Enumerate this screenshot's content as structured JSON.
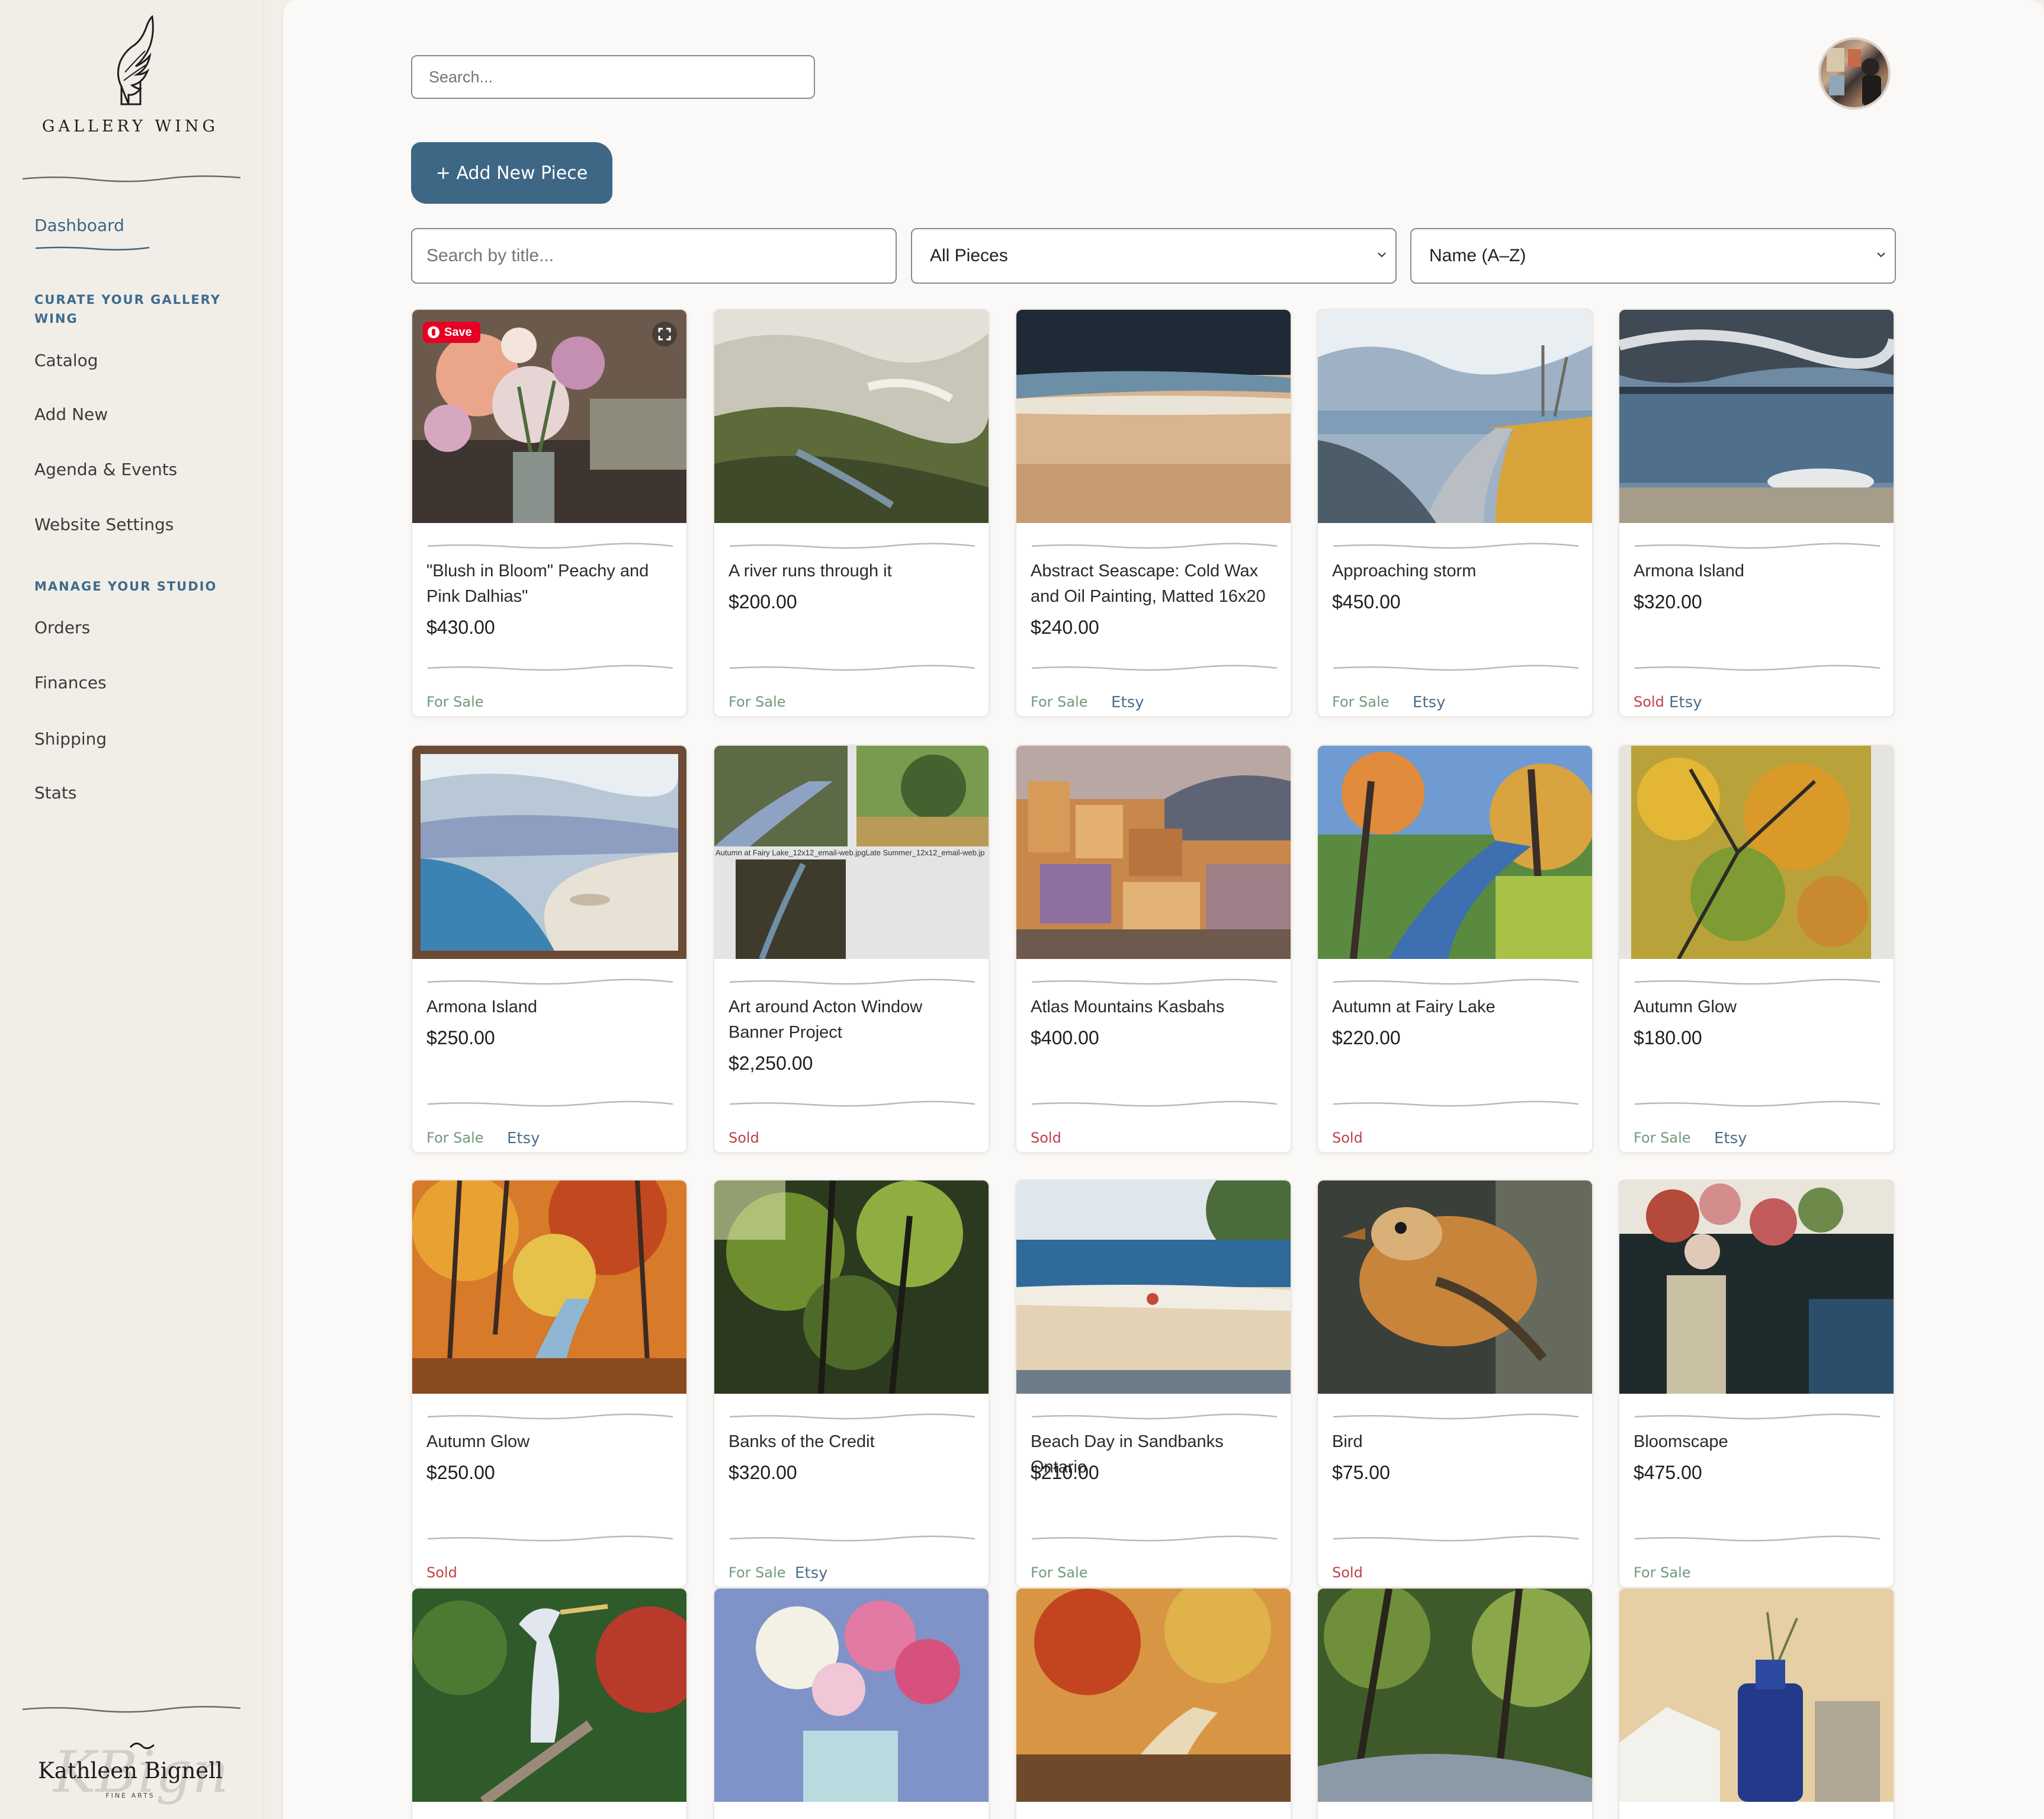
{
  "brand": {
    "name": "GALLERY WING"
  },
  "sidebar": {
    "dashboard": "Dashboard",
    "section1": "CURATE YOUR GALLERY WING",
    "curate_links": [
      "Catalog",
      "Add New",
      "Agenda & Events",
      "Website Settings"
    ],
    "section2": "MANAGE YOUR STUDIO",
    "manage_links": [
      "Orders",
      "Finances",
      "Shipping",
      "Stats"
    ],
    "footer_logo": {
      "name": "Kathleen Bignell",
      "sub": "FINE ARTS"
    }
  },
  "header": {
    "search_placeholder": "Search..."
  },
  "toolbar": {
    "add_label": "+ Add New Piece",
    "title_placeholder": "Search by title...",
    "filter_value": "All Pieces",
    "sort_value": "Name (A–Z)"
  },
  "pinterest": {
    "save_label": "Save"
  },
  "colors": {
    "accent": "#3e6785",
    "for_sale": "#6f9a7c",
    "sold": "#c0414a",
    "etsy": "#4d6f8e"
  },
  "artworks": [
    {
      "title": "\"Blush in Bloom\" Peachy and Pink Dalhias\"",
      "price": "$430.00",
      "status": "For Sale",
      "etsy": ""
    },
    {
      "title": "A river runs through it",
      "price": "$200.00",
      "status": "For Sale",
      "etsy": ""
    },
    {
      "title": "Abstract Seascape: Cold Wax and Oil Painting, Matted 16x20",
      "price": "$240.00",
      "status": "For Sale",
      "etsy": "Etsy"
    },
    {
      "title": "Approaching storm",
      "price": "$450.00",
      "status": "For Sale",
      "etsy": "Etsy"
    },
    {
      "title": "Armona Island",
      "price": "$320.00",
      "status": "Sold",
      "etsy": "Etsy"
    },
    {
      "title": "Armona Island",
      "price": "$250.00",
      "status": "For Sale",
      "etsy": "Etsy"
    },
    {
      "title": "Art around Acton Window Banner Project",
      "price": "$2,250.00",
      "status": "Sold",
      "etsy": "",
      "overlay_text": "Autumn at Fairy Lake_12x12_email-web.jpgLate Summer_12x12_email-web.jp"
    },
    {
      "title": "Atlas Mountains Kasbahs",
      "price": "$400.00",
      "status": "Sold",
      "etsy": ""
    },
    {
      "title": "Autumn at Fairy Lake",
      "price": "$220.00",
      "status": "Sold",
      "etsy": ""
    },
    {
      "title": "Autumn Glow",
      "price": "$180.00",
      "status": "For Sale",
      "etsy": "Etsy"
    },
    {
      "title": "Autumn Glow",
      "price": "$250.00",
      "status": "Sold",
      "etsy": ""
    },
    {
      "title": "Banks of the Credit",
      "price": "$320.00",
      "status": "For Sale",
      "etsy": "Etsy"
    },
    {
      "title": "Beach Day in Sandbanks Ontario",
      "price": "$210.00",
      "status": "For Sale",
      "etsy": ""
    },
    {
      "title": "Bird",
      "price": "$75.00",
      "status": "Sold",
      "etsy": ""
    },
    {
      "title": "Bloomscape",
      "price": "$475.00",
      "status": "For Sale",
      "etsy": ""
    }
  ]
}
